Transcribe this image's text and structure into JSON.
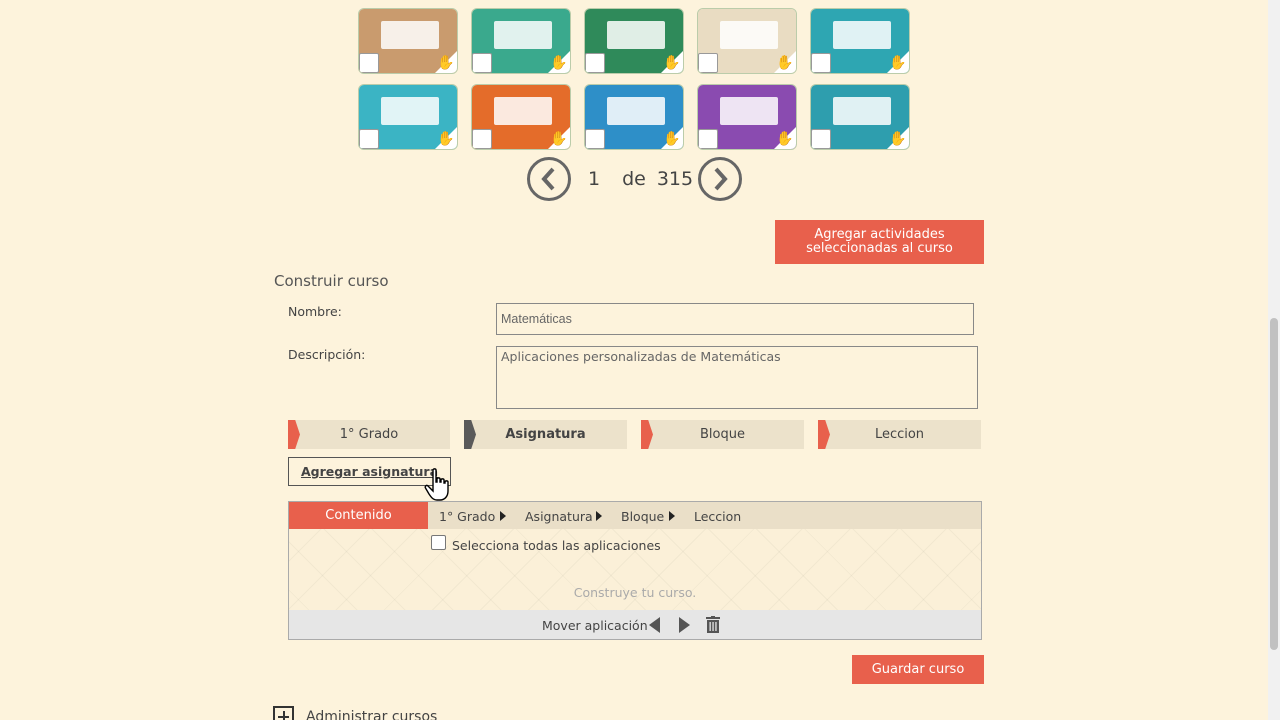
{
  "activities": {
    "thumbnails": [
      {
        "name": "activity-1",
        "bg": "#c99b6e"
      },
      {
        "name": "activity-2",
        "bg": "#3aa98d"
      },
      {
        "name": "activity-3",
        "bg": "#2f8a5a"
      },
      {
        "name": "activity-4",
        "bg": "#e9dcc2"
      },
      {
        "name": "activity-5",
        "bg": "#2ea6b2"
      },
      {
        "name": "activity-6",
        "bg": "#3bb4c4"
      },
      {
        "name": "activity-7",
        "bg": "#e46c2a"
      },
      {
        "name": "activity-8",
        "bg": "#2e8fc8"
      },
      {
        "name": "activity-9",
        "bg": "#8a4bb0"
      },
      {
        "name": "activity-10",
        "bg": "#2e9eae"
      }
    ]
  },
  "pager": {
    "current": "1",
    "of_label": "de",
    "total": "315",
    "prev_icon": "chevron-left-icon",
    "next_icon": "chevron-right-icon"
  },
  "add_selected_button": "Agregar actividades seleccionadas al curso",
  "build_course": {
    "title": "Construir curso",
    "name_label": "Nombre:",
    "name_value": "Matemáticas",
    "description_label": "Descripción:",
    "description_value": "Aplicaciones personalizadas de Matemáticas"
  },
  "steps": [
    "1° Grado",
    "Asignatura",
    "Bloque",
    "Leccion"
  ],
  "add_subject_button": "Agregar asignatura",
  "content": {
    "tab_label": "Contenido",
    "breadcrumb": [
      "1° Grado",
      "Asignatura",
      "Bloque",
      "Leccion"
    ],
    "select_all_label": "Selecciona todas las aplicaciones",
    "placeholder": "Construye tu curso.",
    "move_label": "Mover aplicación"
  },
  "save_button": "Guardar curso",
  "admin_label": "Administrar cursos",
  "colors": {
    "accent": "#e8604c",
    "background": "#fdf3dc"
  }
}
